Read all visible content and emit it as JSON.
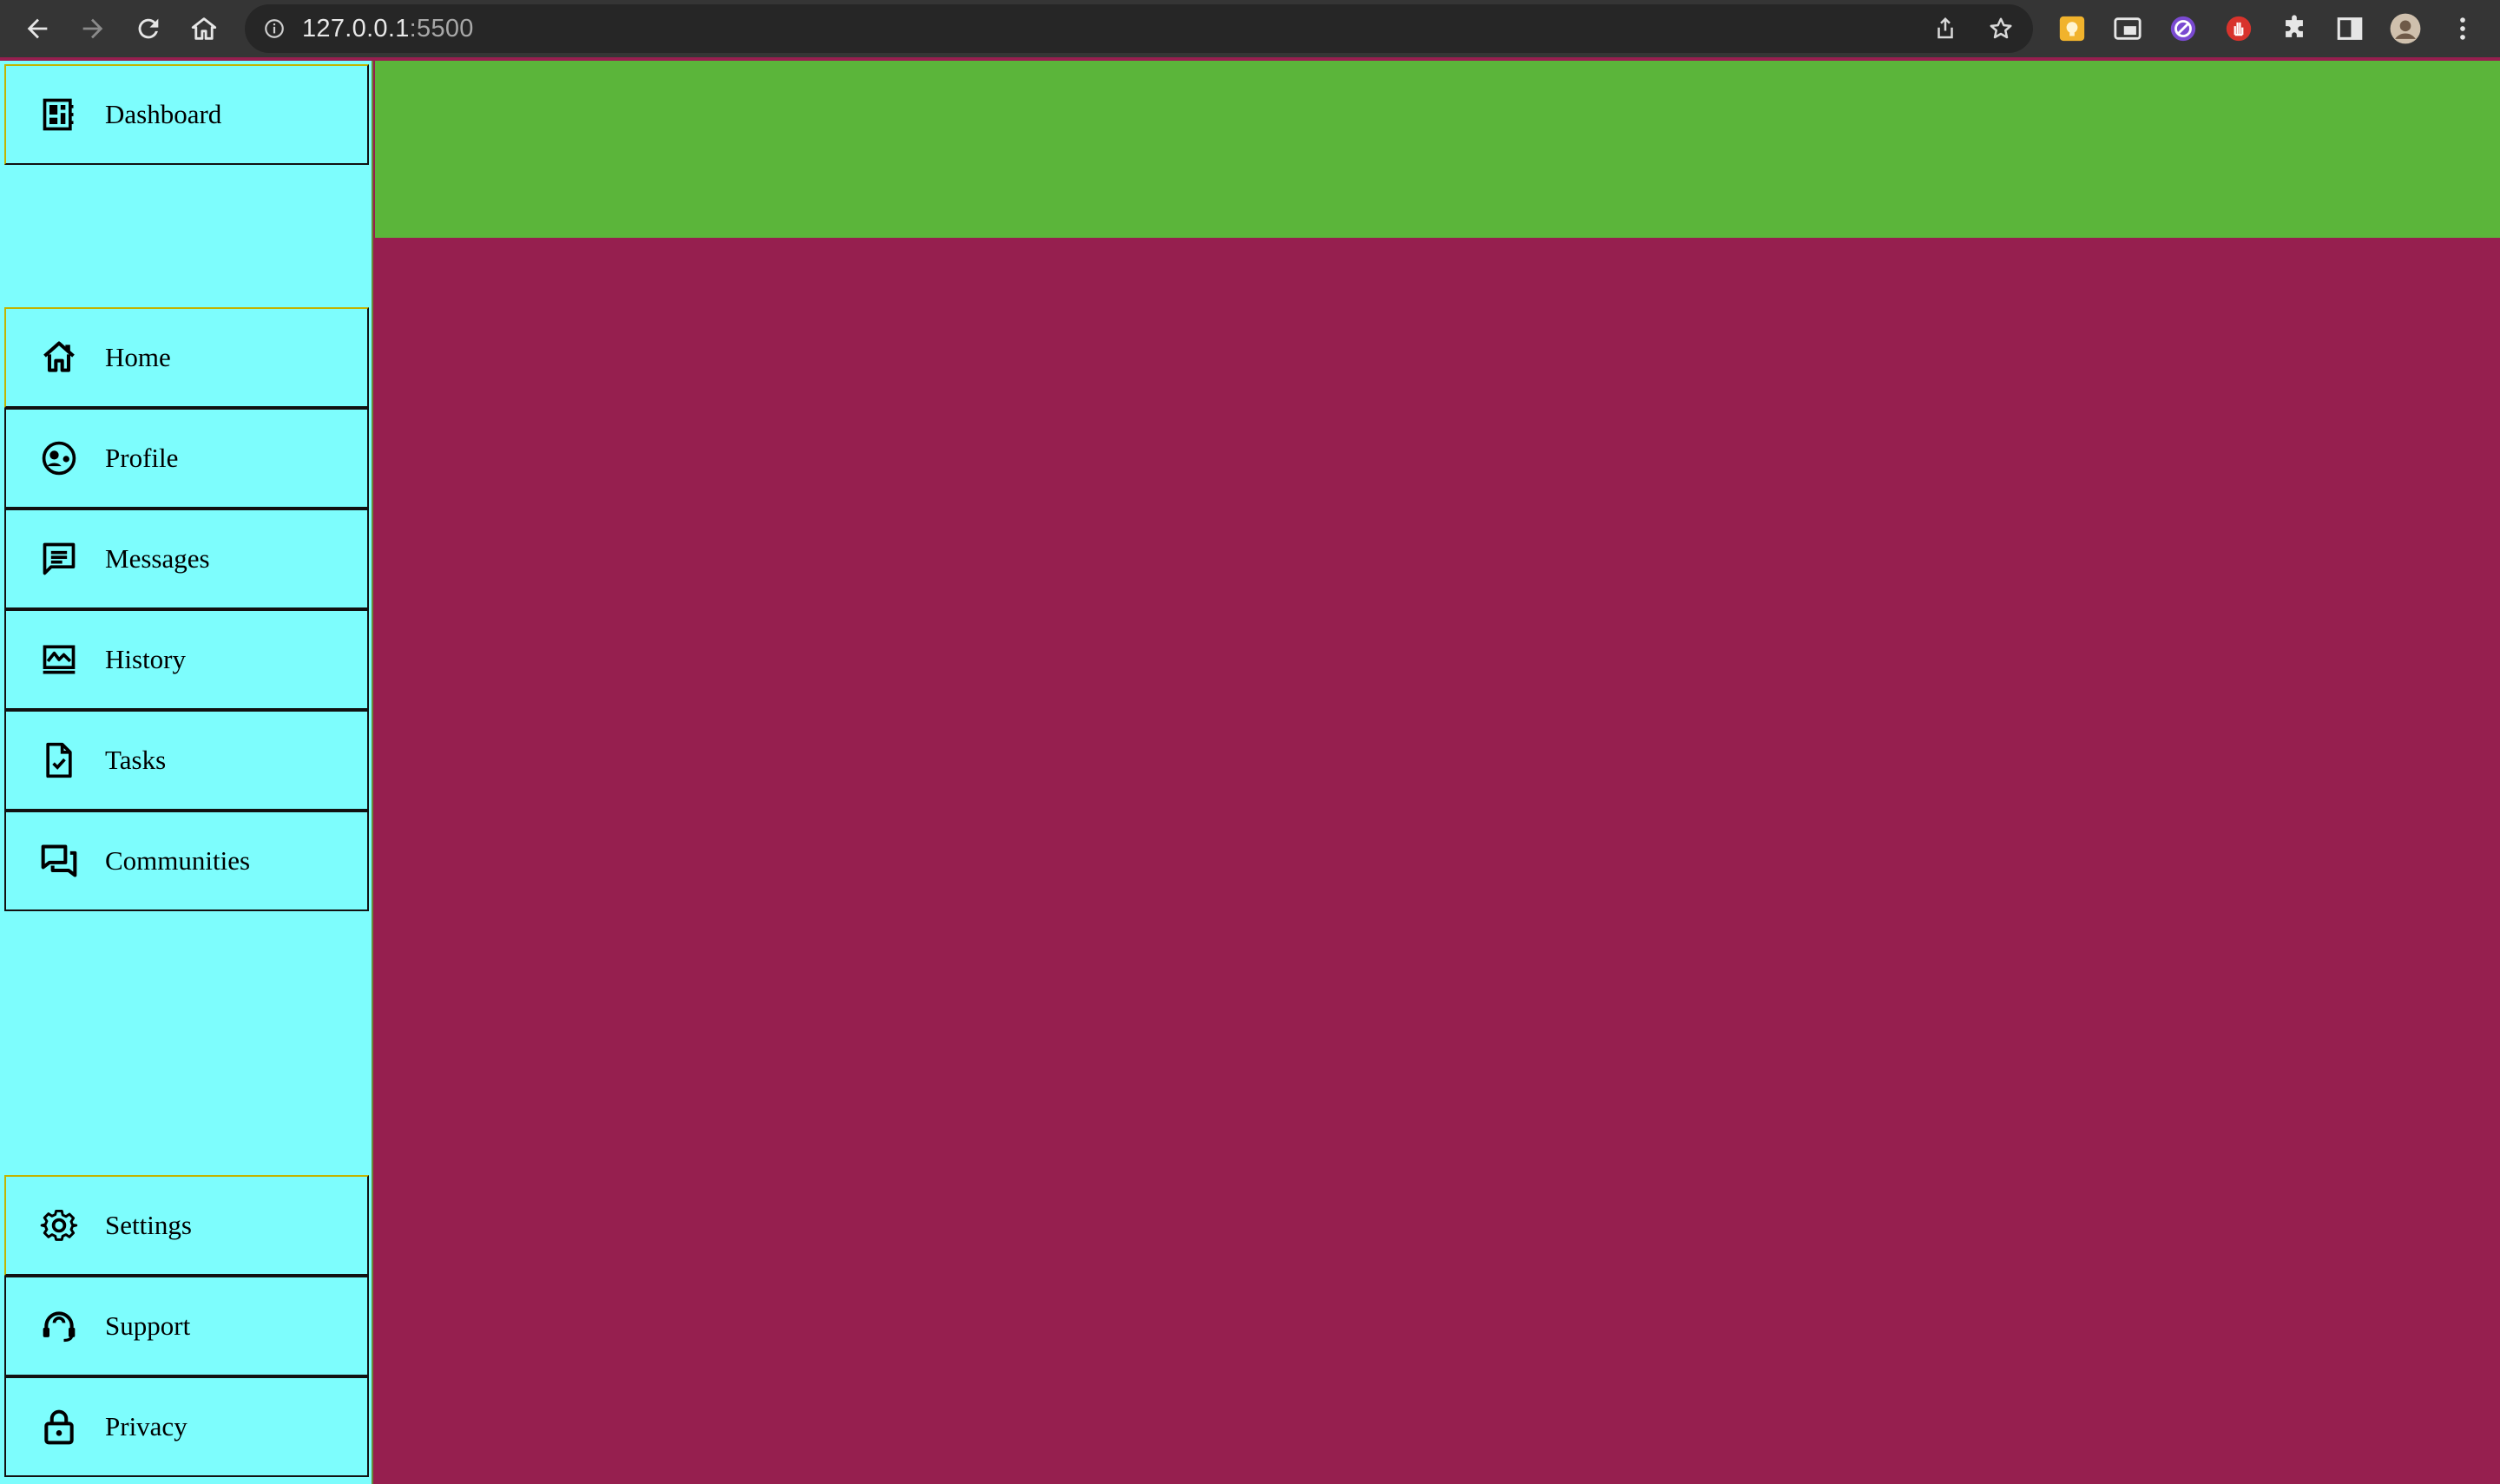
{
  "browser": {
    "url_host": "127.0.0.1",
    "url_port": ":5500"
  },
  "sidebar": {
    "top": [
      {
        "label": "Dashboard",
        "icon": "dashboard-icon"
      }
    ],
    "middle": [
      {
        "label": "Home",
        "icon": "home-icon"
      },
      {
        "label": "Profile",
        "icon": "profile-icon"
      },
      {
        "label": "Messages",
        "icon": "messages-icon"
      },
      {
        "label": "History",
        "icon": "history-icon"
      },
      {
        "label": "Tasks",
        "icon": "tasks-icon"
      },
      {
        "label": "Communities",
        "icon": "communities-icon"
      }
    ],
    "bottom": [
      {
        "label": "Settings",
        "icon": "settings-icon"
      },
      {
        "label": "Support",
        "icon": "support-icon"
      },
      {
        "label": "Privacy",
        "icon": "privacy-icon"
      }
    ]
  },
  "colors": {
    "sidebar_bg": "#7dfdfd",
    "topbar_bg": "#5bb53a",
    "main_bg": "#961f4f",
    "chrome_bg": "#353535"
  }
}
